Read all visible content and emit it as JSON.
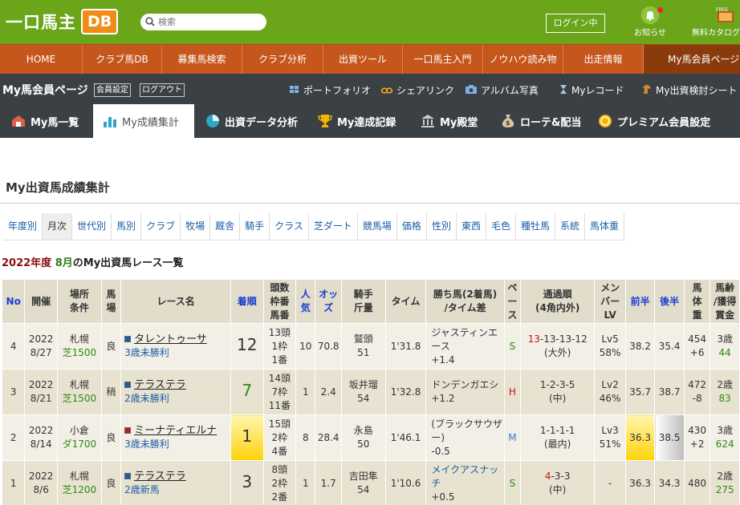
{
  "header": {
    "logo_text": "一口馬主",
    "logo_badge": "DB",
    "search_placeholder": "検索",
    "login_label": "ログイン中",
    "notice_label": "お知らせ",
    "catalog_label": "無料カタログ",
    "catalog_badge": "FREE"
  },
  "nav": [
    "HOME",
    "クラブ馬DB",
    "募集馬検索",
    "クラブ分析",
    "出資ツール",
    "一口馬主入門",
    "ノウハウ読み物",
    "出走情報",
    "My馬会員ページ"
  ],
  "mypage": {
    "title": "My馬会員ページ",
    "settings_btn": "会員設定",
    "logout_btn": "ログアウト",
    "links": [
      "ポートフォリオ",
      "シェアリンク",
      "アルバム写真",
      "Myレコード",
      "My出資検討シート"
    ]
  },
  "tabs": [
    "My馬一覧",
    "My成績集計",
    "出資データ分析",
    "My達成記録",
    "My殿堂",
    "ローテ&配当",
    "プレミアム会員設定"
  ],
  "active_tab": "My成績集計",
  "page_title": "My出資馬成績集計",
  "subtabs": [
    "年度別",
    "月次",
    "世代別",
    "馬別",
    "クラブ",
    "牧場",
    "厩舎",
    "騎手",
    "クラス",
    "芝ダート",
    "競馬場",
    "価格",
    "性別",
    "東西",
    "毛色",
    "種牡馬",
    "系統",
    "馬体重"
  ],
  "active_subtab": "月次",
  "list_heading": {
    "year": "2022年度",
    "month": "8月",
    "rest": "のMy出資馬レース一覧"
  },
  "table": {
    "headers": [
      "No",
      "開催",
      "場所\n条件",
      "馬\n場",
      "レース名",
      "着順",
      "頭数\n枠番\n馬番",
      "人\n気",
      "オッ\nズ",
      "騎手\n斤量",
      "タイム",
      "勝ち馬(2着馬)\n/タイム差",
      "ペ\nー\nス",
      "通過順\n(4角内外)",
      "メン\nバー\nLV",
      "前半",
      "後半",
      "馬\n体\n重",
      "馬齢\n/獲得\n賞金"
    ],
    "rows": [
      {
        "no": "4",
        "year": "2022",
        "date": "8/27",
        "place": "札幌",
        "cond": "芝1500",
        "track": "良",
        "horse": "タレントゥーサ",
        "flag": "#1a5ea8",
        "race_class": "3歳未勝利",
        "finish": "12",
        "field": "13頭",
        "gate": "1枠",
        "num": "1番",
        "pop": "10",
        "odds": "70.8",
        "jockey": "鷲頭",
        "weight": "51",
        "time": "1'31.8",
        "winner": "ジャスティンエース",
        "diff": "+1.4",
        "pace": "S",
        "pass_first": "13",
        "pass_rest": "-13-13-12",
        "pass_pos": "(大外)",
        "lv": "Lv5",
        "lv_pct": "58%",
        "first_half": "38.2",
        "second_half": "35.4",
        "body": "454",
        "body_diff": "+6",
        "age": "3歳",
        "prize": "44"
      },
      {
        "no": "3",
        "year": "2022",
        "date": "8/21",
        "place": "札幌",
        "cond": "芝1500",
        "track": "稍",
        "horse": "テラステラ",
        "flag": "#1a5ea8",
        "race_class": "2歳未勝利",
        "finish": "7",
        "field": "14頭",
        "gate": "7枠",
        "num": "11番",
        "pop": "1",
        "odds": "2.4",
        "jockey": "坂井瑠",
        "weight": "54",
        "time": "1'32.8",
        "winner": "ドンデンガエシ",
        "diff": "+1.2",
        "pace": "H",
        "pass_first": "",
        "pass_rest": "1-2-3-5",
        "pass_pos": "(中)",
        "lv": "Lv2",
        "lv_pct": "46%",
        "first_half": "35.7",
        "second_half": "38.7",
        "body": "472",
        "body_diff": "-8",
        "age": "2歳",
        "prize": "83"
      },
      {
        "no": "2",
        "year": "2022",
        "date": "8/14",
        "place": "小倉",
        "cond": "ダ1700",
        "track": "良",
        "horse": "ミーナティエルナ",
        "flag": "#c01818",
        "race_class": "3歳未勝利",
        "finish": "1",
        "field": "15頭",
        "gate": "2枠",
        "num": "4番",
        "pop": "8",
        "odds": "28.4",
        "jockey": "永島",
        "weight": "50",
        "time": "1'46.1",
        "winner": "(ブラックサウザー)",
        "diff": "-0.5",
        "pace": "M",
        "pass_first": "",
        "pass_rest": "1-1-1-1",
        "pass_pos": "(最内)",
        "lv": "Lv3",
        "lv_pct": "51%",
        "first_half": "36.3",
        "second_half": "38.5",
        "body": "430",
        "body_diff": "+2",
        "age": "3歳",
        "prize": "624"
      },
      {
        "no": "1",
        "year": "2022",
        "date": "8/6",
        "place": "札幌",
        "cond": "芝1200",
        "track": "良",
        "horse": "テラステラ",
        "flag": "#1a5ea8",
        "race_class": "2歳新馬",
        "finish": "3",
        "field": "8頭",
        "gate": "2枠",
        "num": "2番",
        "pop": "1",
        "odds": "1.7",
        "jockey": "吉田隼",
        "weight": "54",
        "time": "1'10.6",
        "winner": "メイクアスナッチ",
        "diff": "+0.5",
        "pace": "S",
        "pass_first": "4",
        "pass_rest": "-3-3",
        "pass_pos": "(中)",
        "lv": "-",
        "lv_pct": "",
        "first_half": "36.3",
        "second_half": "34.3",
        "body": "480",
        "body_diff": "",
        "age": "2歳",
        "prize": "275"
      }
    ]
  },
  "colors": {
    "header_green": "#6aa51a",
    "nav_orange": "#c5561c",
    "dark_bar": "#3a4044",
    "link_blue": "#1a5ea8"
  }
}
